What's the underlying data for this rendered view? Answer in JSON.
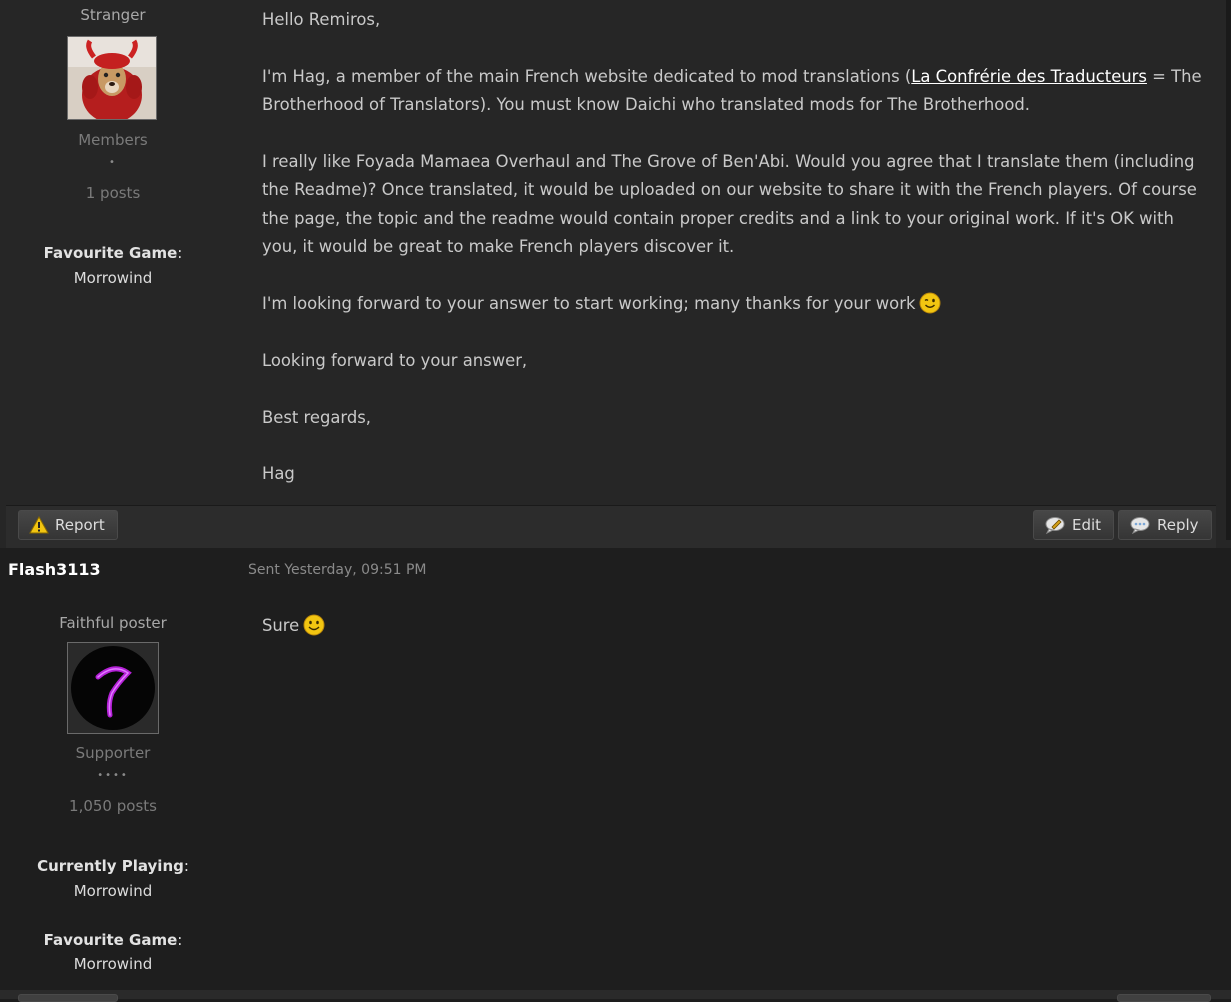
{
  "post1": {
    "rank_title": "Stranger",
    "group": "Members",
    "pips": "•",
    "posts_count": "1 posts",
    "fields": [
      {
        "label": "Favourite Game",
        "value": "Morrowind"
      }
    ],
    "paragraphs": {
      "greeting": "Hello Remiros,",
      "intro_before_link": "I'm Hag, a member of the main French website dedicated to mod translations (",
      "link_text": "La Confrérie des Traducteurs",
      "intro_after_link": " = The Brotherhood of Translators). You must know Daichi who translated mods for The Brotherhood.",
      "request": "I really like Foyada Mamaea Overhaul and The Grove of Ben'Abi. Would you agree that I translate them (including the Readme)? Once translated, it would be uploaded on our website to share it with the French players. Of course the page, the topic and the readme would contain proper credits and a link to your original work. If it's OK with you, it would be great to make French players discover it.",
      "thanks": "I'm looking forward to your answer to start working; many thanks for your work",
      "closing1": "Looking forward to your answer,",
      "closing2": "Best regards,",
      "signature": "Hag"
    },
    "smiley": "wink-smiley",
    "actions": {
      "report_label": "Report",
      "edit_label": "Edit",
      "reply_label": "Reply"
    }
  },
  "post2": {
    "username": "Flash3113",
    "sent": "Sent Yesterday, 09:51 PM",
    "rank_title": "Faithful poster",
    "group": "Supporter",
    "pips": "••••",
    "posts_count": "1,050 posts",
    "fields": [
      {
        "label": "Currently Playing",
        "value": "Morrowind"
      },
      {
        "label": "Favourite Game",
        "value": "Morrowind"
      }
    ],
    "body_text": "Sure",
    "smiley": "smile-smiley"
  },
  "colors": {
    "page_bg": "#1d1d1d",
    "post_bg": "#262626",
    "text": "#c9c9c9",
    "link": "#ffffff",
    "username": "#ffffff"
  }
}
